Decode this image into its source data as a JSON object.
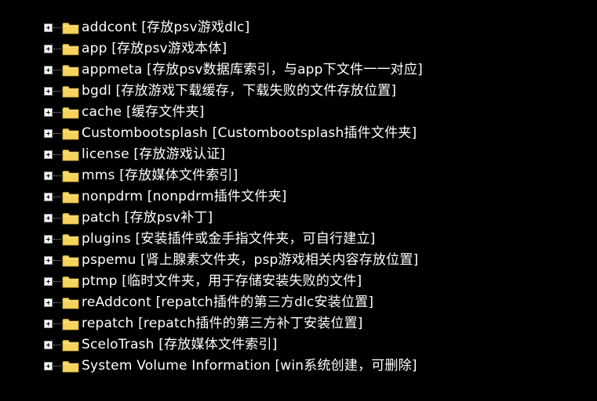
{
  "tree": {
    "items": [
      {
        "name": "addcont",
        "desc": "[存放psv游戏dlc]"
      },
      {
        "name": "app",
        "desc": "[存放psv游戏本体]"
      },
      {
        "name": "appmeta",
        "desc": "[存放psv数据库索引，与app下文件一一对应]"
      },
      {
        "name": "bgdl",
        "desc": "[存放游戏下载缓存，下载失败的文件存放位置]"
      },
      {
        "name": "cache",
        "desc": "[缓存文件夹]"
      },
      {
        "name": "Custombootsplash",
        "desc": "[Custombootsplash插件文件夹]"
      },
      {
        "name": "license",
        "desc": "[存放游戏认证]"
      },
      {
        "name": "mms",
        "desc": "[存放媒体文件索引]"
      },
      {
        "name": "nonpdrm",
        "desc": "[nonpdrm插件文件夹]"
      },
      {
        "name": "patch",
        "desc": "[存放psv补丁]"
      },
      {
        "name": "plugins",
        "desc": "[安装插件或金手指文件夹，可自行建立]"
      },
      {
        "name": "pspemu",
        "desc": "[肾上腺素文件夹，psp游戏相关内容存放位置]"
      },
      {
        "name": "ptmp",
        "desc": "[临时文件夹，用于存储安装失败的文件]"
      },
      {
        "name": "reAddcont",
        "desc": "[repatch插件的第三方dlc安装位置]"
      },
      {
        "name": "repatch",
        "desc": "[repatch插件的第三方补丁安装位置]"
      },
      {
        "name": "SceloTrash",
        "desc": "[存放媒体文件索引]"
      },
      {
        "name": "System Volume Information",
        "desc": "[win系统创建，可删除]"
      }
    ]
  },
  "colors": {
    "background": "#000000",
    "text": "#ffffff",
    "folder": "#f5d35c"
  },
  "icons": {
    "expander": "plus-box-icon",
    "folder": "folder-icon"
  }
}
